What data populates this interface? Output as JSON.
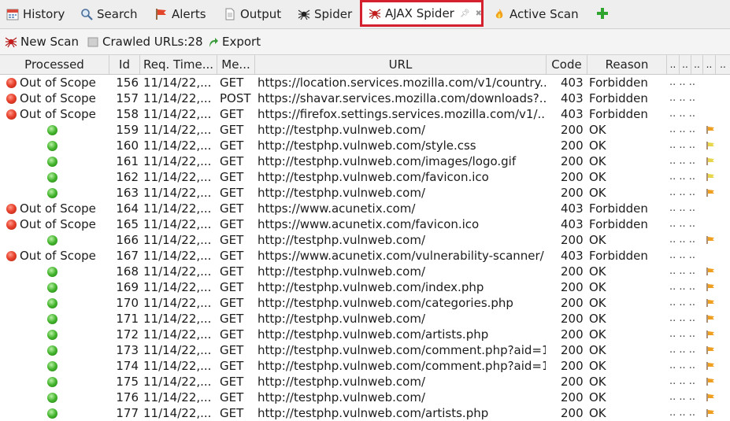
{
  "tabs": [
    {
      "label": "History",
      "icon": "history-icon"
    },
    {
      "label": "Search",
      "icon": "search-icon"
    },
    {
      "label": "Alerts",
      "icon": "alerts-flag-icon"
    },
    {
      "label": "Output",
      "icon": "output-document-icon"
    },
    {
      "label": "Spider",
      "icon": "spider-icon"
    },
    {
      "label": "AJAX Spider",
      "icon": "ajax-spider-icon",
      "active": true
    },
    {
      "label": "Active Scan",
      "icon": "active-scan-flame-icon"
    }
  ],
  "toolbar": {
    "new_scan": "New Scan",
    "crawled": "Crawled URLs:28",
    "export": "Export"
  },
  "columns": {
    "processed": "Processed",
    "id": "Id",
    "req_time": "Req. Time...",
    "method": "Me...",
    "url": "URL",
    "code": "Code",
    "reason": "Reason"
  },
  "rows": [
    {
      "processed": "Out of Scope",
      "status": "red",
      "id": "156",
      "time": "11/14/22,...",
      "method": "GET",
      "url": "https://location.services.mozilla.com/v1/country...",
      "code": "403",
      "reason": "Forbidden",
      "extra": ".. .. ..",
      "flag": ""
    },
    {
      "processed": "Out of Scope",
      "status": "red",
      "id": "157",
      "time": "11/14/22,...",
      "method": "POST",
      "url": "https://shavar.services.mozilla.com/downloads?...",
      "code": "403",
      "reason": "Forbidden",
      "extra": ".. .. ..",
      "flag": ""
    },
    {
      "processed": "Out of Scope",
      "status": "red",
      "id": "158",
      "time": "11/14/22,...",
      "method": "GET",
      "url": "https://firefox.settings.services.mozilla.com/v1/...",
      "code": "403",
      "reason": "Forbidden",
      "extra": ".. .. ..",
      "flag": ""
    },
    {
      "processed": "",
      "status": "green",
      "id": "159",
      "time": "11/14/22,...",
      "method": "GET",
      "url": "http://testphp.vulnweb.com/",
      "code": "200",
      "reason": "OK",
      "extra": ".. .. ..",
      "flag": "orange"
    },
    {
      "processed": "",
      "status": "green",
      "id": "160",
      "time": "11/14/22,...",
      "method": "GET",
      "url": "http://testphp.vulnweb.com/style.css",
      "code": "200",
      "reason": "OK",
      "extra": ".. .. ..",
      "flag": "yellow"
    },
    {
      "processed": "",
      "status": "green",
      "id": "161",
      "time": "11/14/22,...",
      "method": "GET",
      "url": "http://testphp.vulnweb.com/images/logo.gif",
      "code": "200",
      "reason": "OK",
      "extra": ".. .. ..",
      "flag": "yellow"
    },
    {
      "processed": "",
      "status": "green",
      "id": "162",
      "time": "11/14/22,...",
      "method": "GET",
      "url": "http://testphp.vulnweb.com/favicon.ico",
      "code": "200",
      "reason": "OK",
      "extra": ".. .. ..",
      "flag": "yellow"
    },
    {
      "processed": "",
      "status": "green",
      "id": "163",
      "time": "11/14/22,...",
      "method": "GET",
      "url": "http://testphp.vulnweb.com/",
      "code": "200",
      "reason": "OK",
      "extra": ".. .. ..",
      "flag": "orange"
    },
    {
      "processed": "Out of Scope",
      "status": "red",
      "id": "164",
      "time": "11/14/22,...",
      "method": "GET",
      "url": "https://www.acunetix.com/",
      "code": "403",
      "reason": "Forbidden",
      "extra": ".. .. ..",
      "flag": ""
    },
    {
      "processed": "Out of Scope",
      "status": "red",
      "id": "165",
      "time": "11/14/22,...",
      "method": "GET",
      "url": "https://www.acunetix.com/favicon.ico",
      "code": "403",
      "reason": "Forbidden",
      "extra": ".. .. ..",
      "flag": ""
    },
    {
      "processed": "",
      "status": "green",
      "id": "166",
      "time": "11/14/22,...",
      "method": "GET",
      "url": "http://testphp.vulnweb.com/",
      "code": "200",
      "reason": "OK",
      "extra": ".. .. ..",
      "flag": "orange"
    },
    {
      "processed": "Out of Scope",
      "status": "red",
      "id": "167",
      "time": "11/14/22,...",
      "method": "GET",
      "url": "https://www.acunetix.com/vulnerability-scanner/",
      "code": "403",
      "reason": "Forbidden",
      "extra": ".. .. ..",
      "flag": ""
    },
    {
      "processed": "",
      "status": "green",
      "id": "168",
      "time": "11/14/22,...",
      "method": "GET",
      "url": "http://testphp.vulnweb.com/",
      "code": "200",
      "reason": "OK",
      "extra": ".. .. ..",
      "flag": "orange"
    },
    {
      "processed": "",
      "status": "green",
      "id": "169",
      "time": "11/14/22,...",
      "method": "GET",
      "url": "http://testphp.vulnweb.com/index.php",
      "code": "200",
      "reason": "OK",
      "extra": ".. .. ..",
      "flag": "orange"
    },
    {
      "processed": "",
      "status": "green",
      "id": "170",
      "time": "11/14/22,...",
      "method": "GET",
      "url": "http://testphp.vulnweb.com/categories.php",
      "code": "200",
      "reason": "OK",
      "extra": ".. .. ..",
      "flag": "orange"
    },
    {
      "processed": "",
      "status": "green",
      "id": "171",
      "time": "11/14/22,...",
      "method": "GET",
      "url": "http://testphp.vulnweb.com/",
      "code": "200",
      "reason": "OK",
      "extra": ".. .. ..",
      "flag": "orange"
    },
    {
      "processed": "",
      "status": "green",
      "id": "172",
      "time": "11/14/22,...",
      "method": "GET",
      "url": "http://testphp.vulnweb.com/artists.php",
      "code": "200",
      "reason": "OK",
      "extra": ".. .. ..",
      "flag": "orange"
    },
    {
      "processed": "",
      "status": "green",
      "id": "173",
      "time": "11/14/22,...",
      "method": "GET",
      "url": "http://testphp.vulnweb.com/comment.php?aid=1",
      "code": "200",
      "reason": "OK",
      "extra": ".. .. ..",
      "flag": "orange"
    },
    {
      "processed": "",
      "status": "green",
      "id": "174",
      "time": "11/14/22,...",
      "method": "GET",
      "url": "http://testphp.vulnweb.com/comment.php?aid=1",
      "code": "200",
      "reason": "OK",
      "extra": ".. .. ..",
      "flag": "orange"
    },
    {
      "processed": "",
      "status": "green",
      "id": "175",
      "time": "11/14/22,...",
      "method": "GET",
      "url": "http://testphp.vulnweb.com/",
      "code": "200",
      "reason": "OK",
      "extra": ".. .. ..",
      "flag": "orange"
    },
    {
      "processed": "",
      "status": "green",
      "id": "176",
      "time": "11/14/22,...",
      "method": "GET",
      "url": "http://testphp.vulnweb.com/",
      "code": "200",
      "reason": "OK",
      "extra": ".. .. ..",
      "flag": "orange"
    },
    {
      "processed": "",
      "status": "green",
      "id": "177",
      "time": "11/14/22,...",
      "method": "GET",
      "url": "http://testphp.vulnweb.com/artists.php",
      "code": "200",
      "reason": "OK",
      "extra": ".. .. ..",
      "flag": "orange"
    }
  ],
  "colors": {
    "active_tab_border": "#d5202e",
    "flag_orange": "#f0a020",
    "flag_yellow": "#e8d64a"
  }
}
